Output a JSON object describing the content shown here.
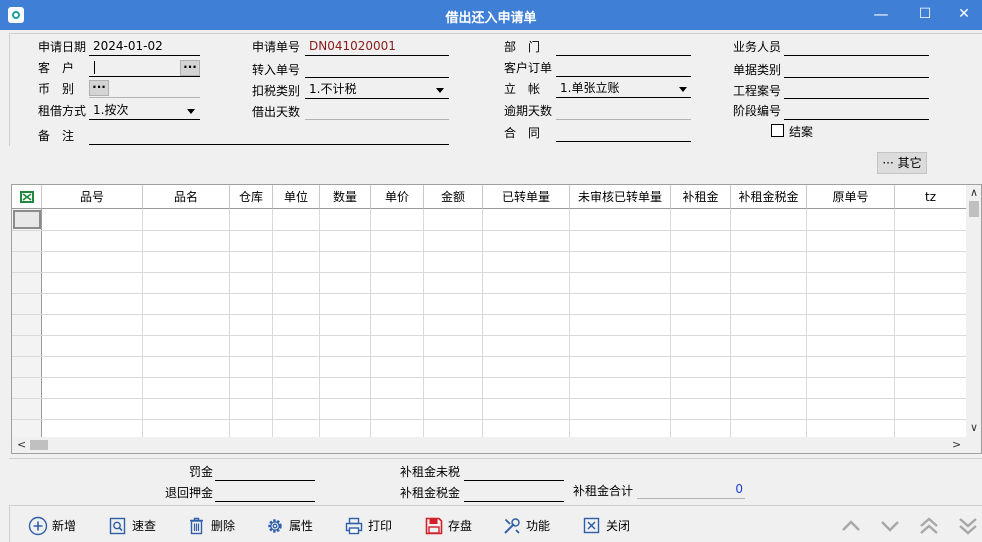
{
  "window": {
    "title": "借出还入申请单",
    "minimize": "—",
    "maximize": "☐",
    "close": "✕"
  },
  "form": {
    "apply_date": {
      "label": "申请日期",
      "value": "2024-01-02"
    },
    "customer": {
      "label": "客　户",
      "value": ""
    },
    "currency": {
      "label": "币　别",
      "value": ""
    },
    "rent_method": {
      "label": "租借方式",
      "value": "1.按次"
    },
    "remark": {
      "label": "备　注",
      "value": ""
    },
    "apply_no": {
      "label": "申请单号",
      "value": "DN041020001"
    },
    "transfer_no": {
      "label": "转入单号",
      "value": ""
    },
    "tax_type": {
      "label": "扣税类别",
      "value": "1.不计税"
    },
    "lend_days": {
      "label": "借出天数",
      "value": ""
    },
    "department": {
      "label": "部　门",
      "value": ""
    },
    "customer_order": {
      "label": "客户订单",
      "value": ""
    },
    "account": {
      "label": "立　帐",
      "value": "1.单张立账"
    },
    "overdue_days": {
      "label": "逾期天数",
      "value": ""
    },
    "contract": {
      "label": "合　同",
      "value": ""
    },
    "salesperson": {
      "label": "业务人员",
      "value": ""
    },
    "doc_category": {
      "label": "单据类别",
      "value": ""
    },
    "project_no": {
      "label": "工程案号",
      "value": ""
    },
    "stage_no": {
      "label": "阶段编号",
      "value": ""
    },
    "closed": {
      "label": "结案"
    },
    "ellipsis": "···",
    "other_button": "··· 其它"
  },
  "grid": {
    "columns": [
      "品号",
      "品名",
      "仓库",
      "单位",
      "数量",
      "单价",
      "金额",
      "已转单量",
      "未审核已转单量",
      "补租金",
      "补租金税金",
      "原单号",
      "tz"
    ],
    "scroll_up": "∧",
    "scroll_down": "∨",
    "scroll_left": "<",
    "scroll_right": ">"
  },
  "summary": {
    "penalty": {
      "label": "罚金",
      "value": ""
    },
    "refund_deposit": {
      "label": "退回押金",
      "value": ""
    },
    "rent_untaxed": {
      "label": "补租金未税",
      "value": ""
    },
    "rent_tax": {
      "label": "补租金税金",
      "value": ""
    },
    "rent_total": {
      "label": "补租金合计",
      "value": "0"
    }
  },
  "toolbar": {
    "add": "新增",
    "quick_search": "速查",
    "delete": "删除",
    "properties": "属性",
    "print": "打印",
    "save": "存盘",
    "function": "功能",
    "close": "关闭"
  },
  "colors": {
    "titlebar": "#3f7fd6",
    "save_icon": "#d0202a",
    "icon_blue": "#2f5fa8",
    "total_value": "#1a3ed6"
  }
}
